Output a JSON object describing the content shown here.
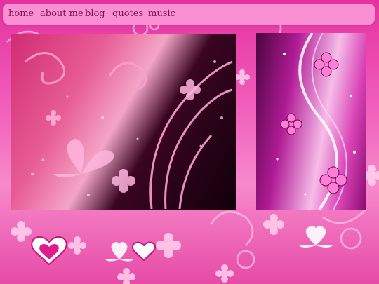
{
  "nav": {
    "items": [
      {
        "label": "home"
      },
      {
        "label": "about me"
      },
      {
        "label": "blog"
      },
      {
        "label": "quotes"
      },
      {
        "label": "music"
      }
    ]
  },
  "images": {
    "main": "pink glitter floral butterfly artwork",
    "side": "pink floral swirl vertical artwork"
  },
  "colors": {
    "nav_bg": "#fb8fd3",
    "nav_text": "#7a0f55",
    "page_bg": "#ee5ab5"
  }
}
